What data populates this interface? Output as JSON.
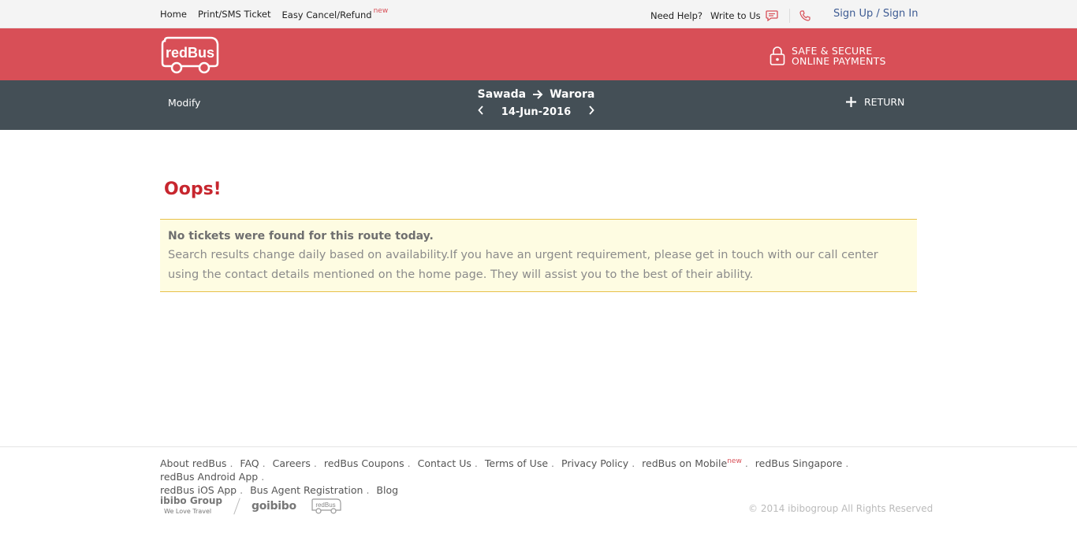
{
  "topnav": {
    "links": [
      "Home",
      "Print/SMS Ticket",
      "Easy Cancel/Refund"
    ],
    "new_badge": "new",
    "need_help": "Need Help?",
    "write_to_us": "Write to Us",
    "signin": "Sign Up / Sign In"
  },
  "header": {
    "logo_text": "redBus",
    "secure_line1": "SAFE & SECURE",
    "secure_line2": "ONLINE PAYMENTS"
  },
  "routebar": {
    "modify": "Modify",
    "from": "Sawada",
    "to": "Warora",
    "date": "14-Jun-2016",
    "return": "RETURN"
  },
  "main": {
    "title": "Oops!",
    "notice_title": "No tickets were found for this route today.",
    "notice_body": "Search results change daily based on availability.If you have an urgent requirement, please get in touch with our call center using the contact details mentioned on the home page. They will assist you to the best of their ability."
  },
  "footer": {
    "links": [
      "About redBus",
      "FAQ",
      "Careers",
      "redBus Coupons",
      "Contact Us",
      "Terms of Use",
      "Privacy Policy",
      "redBus on Mobile",
      "redBus Singapore",
      "redBus Android App",
      "redBus iOS App",
      "Bus Agent Registration",
      "Blog"
    ],
    "new_badge": "new",
    "brand1": "ibibo Group",
    "brand1_tag": "We Love Travel",
    "brand2": "goibibo",
    "brand3": "redBus",
    "copyright": "© 2014 ibibogroup All Rights Reserved"
  },
  "colors": {
    "brand_red": "#d84f57",
    "dark_bar": "#444f56",
    "oops_red": "#c7262e",
    "notice_bg": "#fefce2"
  }
}
